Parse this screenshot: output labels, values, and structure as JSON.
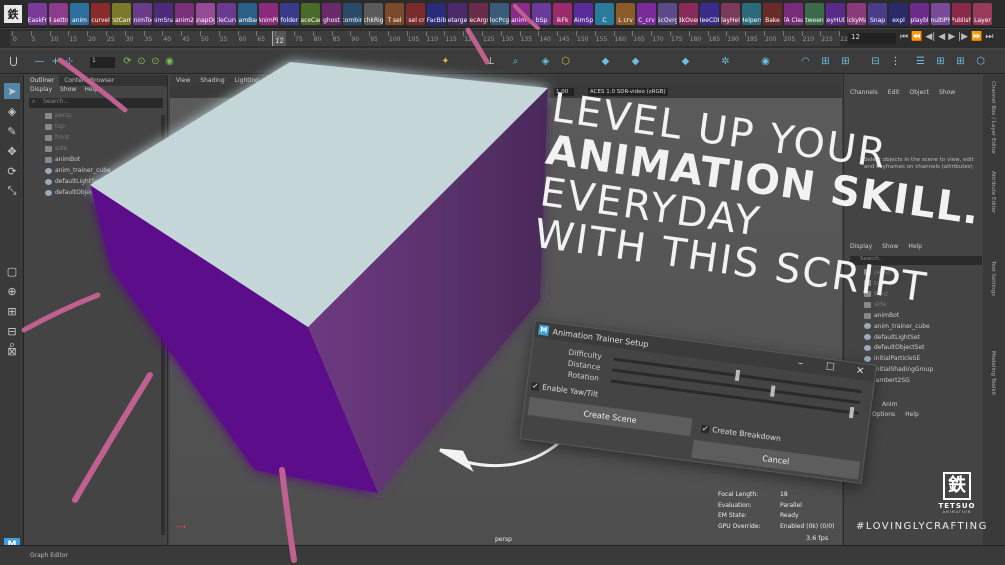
{
  "shelf": {
    "logo": "鉄",
    "buttons": [
      {
        "label": "EaskFr",
        "color": "#7a3a9a"
      },
      {
        "label": "all settng",
        "color": "#8d3c8d"
      },
      {
        "label": "anim",
        "color": "#2d6f9f"
      },
      {
        "label": "curvel",
        "color": "#8a2b2b"
      },
      {
        "label": "rstCam",
        "color": "#7a7a2a"
      },
      {
        "label": "animTog",
        "color": "#6b3b8b"
      },
      {
        "label": "animSnap",
        "color": "#4c2a7a"
      },
      {
        "label": "anim2",
        "color": "#7a2f7a"
      },
      {
        "label": "snapOg",
        "color": "#944a94"
      },
      {
        "label": "cycleCurves",
        "color": "#6b3a8f"
      },
      {
        "label": "camBae",
        "color": "#2a5f8a"
      },
      {
        "label": "AnimPk",
        "color": "#8a2a7a"
      },
      {
        "label": "folder",
        "color": "#3a3a8a"
      },
      {
        "label": "faceCan",
        "color": "#4a6a2a"
      },
      {
        "label": "ghost",
        "color": "#6a2a6a"
      },
      {
        "label": "combin",
        "color": "#2a4a6a"
      },
      {
        "label": "chkRig",
        "color": "#5a5a5a"
      },
      {
        "label": "T sel",
        "color": "#7a4a2a"
      },
      {
        "label": "T sel crv",
        "color": "#7a2a2a"
      },
      {
        "label": "FacBib",
        "color": "#2a2a7a"
      },
      {
        "label": "retarget",
        "color": "#4a2a6a"
      },
      {
        "label": "recArgs",
        "color": "#6a2a4a"
      },
      {
        "label": "locPcg",
        "color": "#3a5a7a"
      },
      {
        "label": "anim4",
        "color": "#8a2a8a"
      },
      {
        "label": "bSp",
        "color": "#6a3a9a"
      },
      {
        "label": "ikFk",
        "color": "#9a2a6a"
      },
      {
        "label": "AimSp",
        "color": "#5a2a9a"
      },
      {
        "label": "C",
        "color": "#2a7a9a"
      },
      {
        "label": "L crv",
        "color": "#8a5a2a"
      },
      {
        "label": "C_crv",
        "color": "#7a2a9a"
      },
      {
        "label": "ScOvrg",
        "color": "#5a4a8a"
      },
      {
        "label": "BkOver",
        "color": "#8a2a5a"
      },
      {
        "label": "BeeCDE",
        "color": "#3a2a8a"
      },
      {
        "label": "playHelp",
        "color": "#7a3a5a"
      },
      {
        "label": "Helpers",
        "color": "#2a6a7a"
      },
      {
        "label": "Bake",
        "color": "#6a2a2a"
      },
      {
        "label": "TA Clea",
        "color": "#7a2a7a"
      },
      {
        "label": "tween",
        "color": "#3a6a4a"
      },
      {
        "label": "keyHUD",
        "color": "#5a2a8a"
      },
      {
        "label": "stickyMan",
        "color": "#8a3a7a"
      },
      {
        "label": "Snap",
        "color": "#4a3a8a"
      },
      {
        "label": "expl",
        "color": "#2a2a6a"
      },
      {
        "label": "playbl",
        "color": "#6a2a8a"
      },
      {
        "label": "multiPly",
        "color": "#7a4a9a"
      },
      {
        "label": "Publish",
        "color": "#8a2a4a"
      },
      {
        "label": "Layer",
        "color": "#9a3a5a"
      }
    ]
  },
  "timeline": {
    "ticks": [
      "0",
      "5",
      "10",
      "15",
      "20",
      "25",
      "30",
      "35",
      "40",
      "45",
      "50",
      "55",
      "60",
      "65",
      "70",
      "75",
      "80",
      "85",
      "90",
      "95",
      "100",
      "105",
      "110",
      "115",
      "120",
      "125",
      "130",
      "135",
      "140",
      "145",
      "150",
      "155",
      "160",
      "165",
      "170",
      "175",
      "180",
      "185",
      "190",
      "195",
      "200",
      "205",
      "210",
      "215",
      "220"
    ],
    "current_frame": "12",
    "frame_field": "12",
    "transport": [
      "⏮",
      "⏪",
      "◀|",
      "◀",
      "▶",
      "|▶",
      "⏩",
      "⏭"
    ]
  },
  "statusline": {
    "snap_field": "1",
    "tool_glyphs": [
      "↔",
      "⟲",
      "⤢",
      "⧉",
      "⊙"
    ]
  },
  "toolbox": {
    "tools": [
      "➤",
      "◈",
      "✎",
      "✥",
      "⟳",
      "⤡",
      "▢",
      "⊕",
      "⊞",
      "⊟",
      "⊠",
      "⌕"
    ]
  },
  "outliner": {
    "tabs": [
      "Outliner",
      "Content Browser"
    ],
    "menu": [
      "Display",
      "Show",
      "Help"
    ],
    "search_placeholder": "Search...",
    "items": [
      {
        "label": "persp",
        "dim": true
      },
      {
        "label": "top",
        "dim": true
      },
      {
        "label": "front",
        "dim": true
      },
      {
        "label": "side",
        "dim": true
      },
      {
        "label": "animBot",
        "dim": false
      },
      {
        "label": "anim_trainer_cube",
        "dim": false
      },
      {
        "label": "defaultLightSet",
        "dim": false
      },
      {
        "label": "defaultObjectSet",
        "dim": false
      }
    ]
  },
  "viewport": {
    "menu": [
      "View",
      "Shading",
      "Lighting",
      "Show",
      "Renderer",
      "Panels"
    ],
    "exposure": "1.00",
    "color_space": "ACES 1.0 SDR-video (sRGB)",
    "camera_name": "persp",
    "hud_labels": [
      "Focal Length:",
      "Evaluation:",
      "EM State:",
      "GPU Override:"
    ],
    "hud_values": [
      "18",
      "Parallel",
      "Ready",
      "Enabled (0k) (0/0)"
    ],
    "fps": "3.6 fps",
    "cube_top_color": "#c4d6d8",
    "cube_front_color": "#5c0a8a",
    "cube_side_color": "#6e3a82"
  },
  "channelbox": {
    "menu": [
      "Channels",
      "Edit",
      "Object",
      "Show"
    ],
    "hint": "Select objects in the scene to view, edit and keyframes on channels (attributes)",
    "layer_menu": [
      "Display",
      "Show",
      "Help"
    ],
    "search_placeholder": "Search...",
    "items": [
      {
        "label": "persp",
        "dim": true
      },
      {
        "label": "top",
        "dim": true
      },
      {
        "label": "front",
        "dim": true
      },
      {
        "label": "side",
        "dim": true
      },
      {
        "label": "animBot",
        "dim": false
      },
      {
        "label": "anim_trainer_cube",
        "dim": false
      },
      {
        "label": "defaultLightSet",
        "dim": false
      },
      {
        "label": "defaultObjectSet",
        "dim": false
      },
      {
        "label": "initialParticleSE",
        "dim": false
      },
      {
        "label": "initialShadingGroup",
        "dim": false
      },
      {
        "label": "lambert2SG",
        "dim": false
      }
    ],
    "anim_tab": "Anim",
    "options": [
      "Options",
      "Help"
    ],
    "side_tabs": [
      "Channel Box / Layer Editor",
      "Attribute Editor",
      "Tool Settings",
      "Modeling Toolkit"
    ]
  },
  "headline": {
    "line1": "LEVEL UP YOUR",
    "line2": "ANIMATION SKILL.",
    "line3": "EVERYDAY",
    "line4": "WITH THIS SCRIPT"
  },
  "dialog": {
    "title": "Animation Trainer Setup",
    "labels": [
      "Difficulty",
      "Distance",
      "Rotation"
    ],
    "sliders": [
      0.5,
      0.65,
      0.98
    ],
    "enable_yaw": "Enable Yaw/Tilt",
    "create_breakdown": "Create Breakdown",
    "create_scene": "Create Scene",
    "cancel": "Cancel"
  },
  "brand": {
    "mark": "鉄",
    "word": "TETSUO",
    "sub": "ANIMATION",
    "hashtag": "#LOVINGLYCRAFTING"
  },
  "bottombar": {
    "graph_editor": "Graph Editor"
  },
  "colors": {
    "accent": "#5285a6",
    "maya_blue": "#3ca2d9",
    "stroke_pink": "#c0608f"
  }
}
